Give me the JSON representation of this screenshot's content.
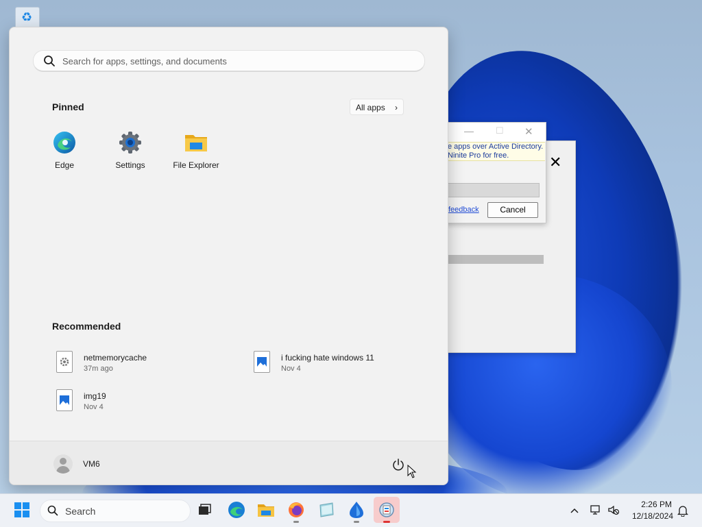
{
  "start_menu": {
    "search": {
      "placeholder": "Search for apps, settings, and documents"
    },
    "pinned": {
      "title": "Pinned",
      "all_apps_label": "All apps",
      "items": [
        {
          "label": "Edge",
          "icon": "edge-icon"
        },
        {
          "label": "Settings",
          "icon": "settings-gear-icon"
        },
        {
          "label": "File Explorer",
          "icon": "folder-icon"
        }
      ]
    },
    "recommended": {
      "title": "Recommended",
      "items": [
        {
          "name": "netmemorycache",
          "time": "37m ago",
          "icon": "settings-file-icon"
        },
        {
          "name": "i fucking hate windows 11",
          "time": "Nov 4",
          "icon": "image-file-icon"
        },
        {
          "name": "img19",
          "time": "Nov 4",
          "icon": "image-file-icon"
        }
      ]
    },
    "user": {
      "name": "VM6"
    }
  },
  "dialog": {
    "notice_line1": "e apps over Active Directory.",
    "notice_line2": "Ninite Pro for free.",
    "feedback_link": "feedback",
    "cancel_label": "Cancel",
    "close_glyph": "✕"
  },
  "taskbar": {
    "search_label": "Search",
    "apps": [
      "task-view-icon",
      "edge-icon",
      "file-explorer-icon",
      "firefox-icon",
      "notepad-icon",
      "ninite-icon",
      "ninite-installer-icon"
    ],
    "active_app": "ninite-installer-icon",
    "time": "2:26 PM",
    "date": "12/18/2024"
  },
  "colors": {
    "accent": "#0067c0",
    "active_app_highlight": "#f7cccc",
    "start_menu_bg": "#f2f2f2",
    "wallpaper_bloom": "#1546d0"
  }
}
